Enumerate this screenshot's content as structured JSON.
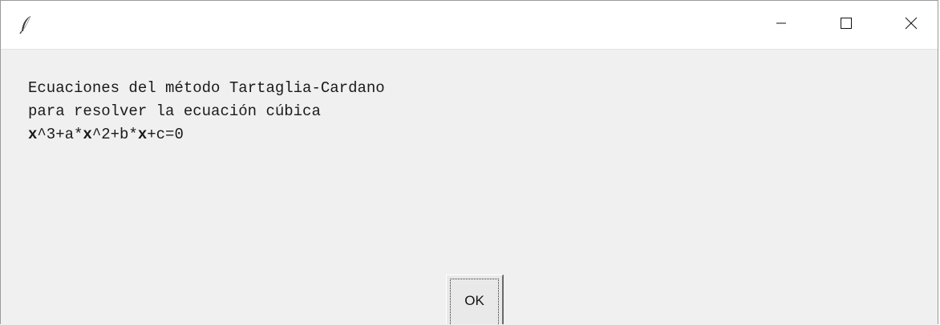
{
  "window": {
    "title": "",
    "icon": "feather-icon",
    "controls": {
      "minimize": "minimize-icon",
      "maximize": "maximize-icon",
      "close": "close-icon"
    }
  },
  "message": {
    "line1": "Ecuaciones del método Tartaglia-Cardano",
    "line2": "para resolver la ecuación cúbica",
    "line3": {
      "x1": "x",
      "p1": "^3+a*",
      "x2": "x",
      "p2": "^2+b*",
      "x3": "x",
      "p3": "+c=0"
    }
  },
  "buttons": {
    "ok_label": "OK"
  }
}
